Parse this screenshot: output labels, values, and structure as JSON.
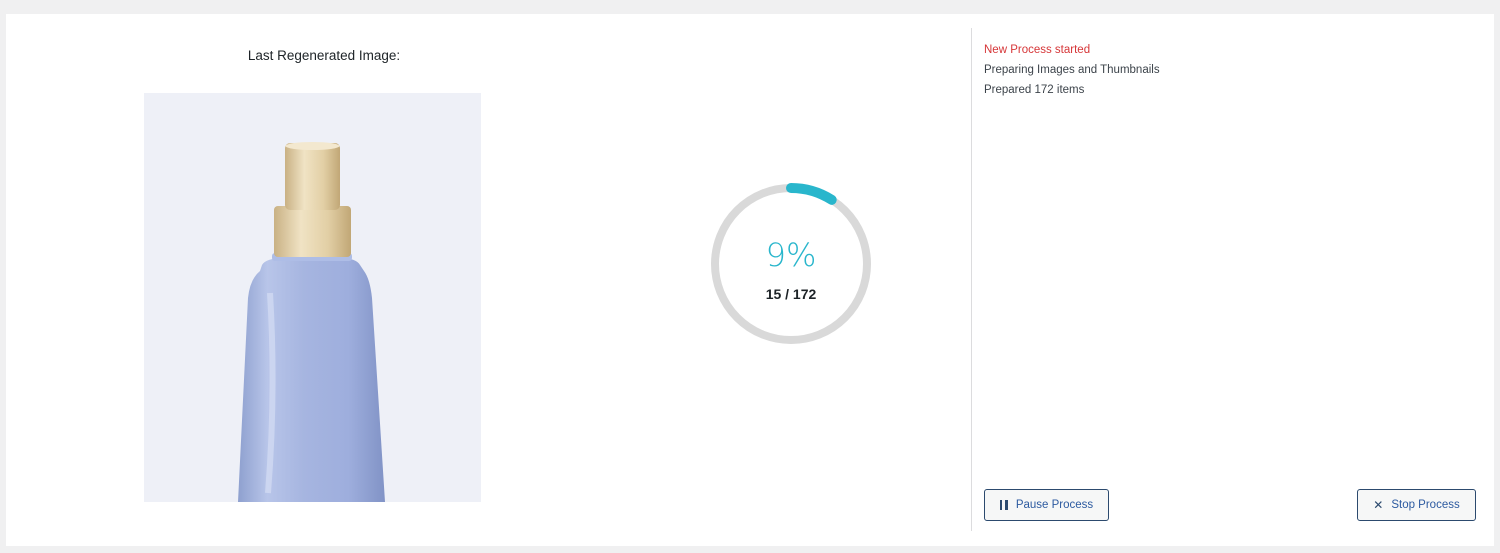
{
  "preview": {
    "label": "Last Regenerated Image:",
    "image_icon": "bottle-image"
  },
  "progress": {
    "percent_label": "9%",
    "percent": 9,
    "count_label": "15 / 172",
    "done": 15,
    "total": 172,
    "accent_color": "#29b6cc",
    "track_color": "#d9d9d9"
  },
  "log": {
    "lines": [
      {
        "text": "New Process started",
        "color": "#d63638"
      },
      {
        "text": "Preparing Images and Thumbnails"
      },
      {
        "text": "Prepared 172 items"
      }
    ]
  },
  "actions": {
    "pause": {
      "label": "Pause Process",
      "icon": "pause-icon"
    },
    "stop": {
      "label": "Stop Process",
      "icon": "close-icon"
    }
  }
}
